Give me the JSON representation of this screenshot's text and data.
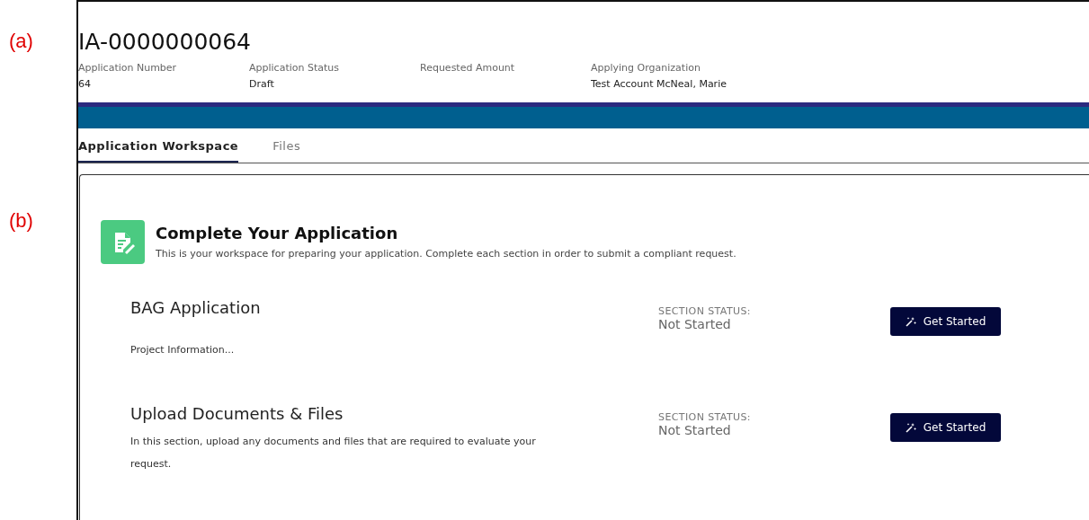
{
  "annotations": [
    {
      "label": "(a)"
    },
    {
      "label": "(b)"
    }
  ],
  "record": {
    "title": "IA-0000000064",
    "fields": [
      {
        "label": "Application Number",
        "value": "64"
      },
      {
        "label": "Application Status",
        "value": "Draft"
      },
      {
        "label": "Requested Amount"
      },
      {
        "label": "Applying Organization",
        "value": "Test Account McNeal, Marie"
      }
    ]
  },
  "tabs": [
    {
      "label": "Application Workspace",
      "selected": true
    },
    {
      "label": "Files",
      "selected": false
    }
  ],
  "workspace": {
    "heading": "Complete Your Application",
    "description": "This is your workspace for preparing your application.  Complete each section in order to submit a compliant request.",
    "sections": [
      {
        "title": "BAG Application",
        "description": "Project Information...",
        "status_label": "SECTION STATUS:",
        "status": "Not Started",
        "button": "Get Started"
      },
      {
        "title": "Upload Documents & Files",
        "description": "In this section, upload any documents and files that are required to evaluate your request.",
        "status_label": "SECTION STATUS:",
        "status": "Not Started",
        "button": "Get Started"
      }
    ]
  }
}
